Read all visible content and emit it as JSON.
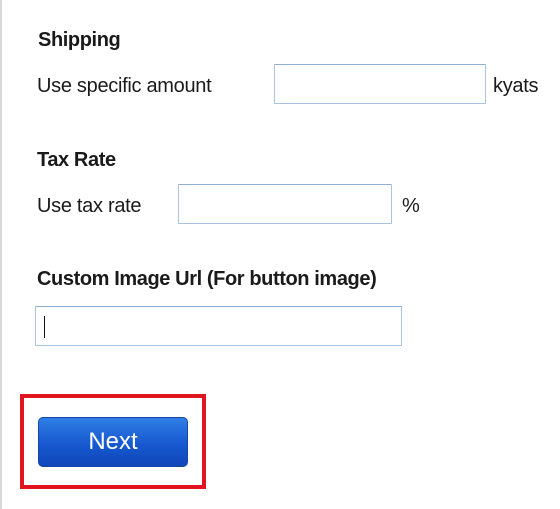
{
  "shipping": {
    "title": "Shipping",
    "amount_label": "Use specific amount",
    "amount_value": "",
    "unit": "kyats"
  },
  "tax": {
    "title": "Tax Rate",
    "rate_label": "Use tax rate",
    "rate_value": "",
    "unit": "%"
  },
  "custom_image": {
    "title": "Custom Image Url (For button image)",
    "url_value": ""
  },
  "actions": {
    "next_label": "Next"
  },
  "colors": {
    "highlight": "#e0151f",
    "button": "#1758cf"
  }
}
